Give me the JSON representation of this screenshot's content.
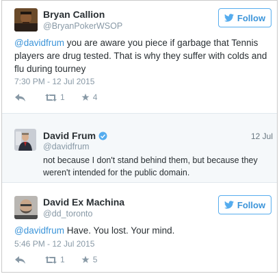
{
  "colors": {
    "link": "#3b94d9",
    "follow_border": "#55acee",
    "meta": "#8899a6"
  },
  "tweets": [
    {
      "name": "Bryan Callion",
      "handle": "@BryanPokerWSOP",
      "follow_label": "Follow",
      "mention": "@davidfrum",
      "text": " you are aware you piece if garbage that Tennis players are drug tested. That is why they suffer with colds and flu during tourney",
      "timestamp": "7:30 PM - 12 Jul 2015",
      "retweets": "1",
      "favorites": "4"
    },
    {
      "name": "David Frum",
      "handle": "@davidfrum",
      "date": "12 Jul",
      "text": "not because I don't stand behind them, but because they weren't intended for the public domain."
    },
    {
      "name": "David Ex Machina",
      "handle": "@dd_toronto",
      "follow_label": "Follow",
      "mention": "@davidfrum",
      "text": " Have. You lost. Your mind.",
      "timestamp": "5:46 PM - 12 Jul 2015",
      "retweets": "1",
      "favorites": "5"
    }
  ]
}
